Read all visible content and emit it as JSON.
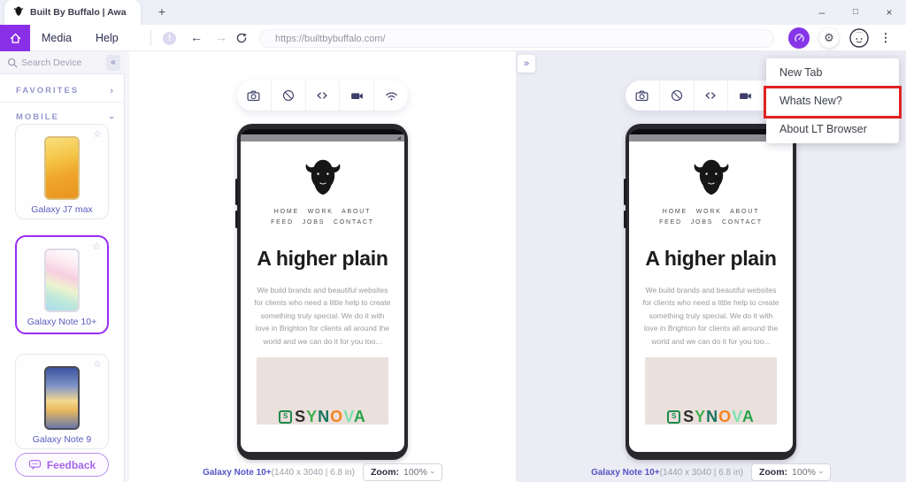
{
  "titlebar": {
    "tab_title": "Built By Buffalo | Awa"
  },
  "icons": {
    "plus": "+",
    "minimize": "–",
    "maximize": "□",
    "close": "×",
    "warning": "!",
    "back_arrow": "←",
    "forward_arrow": "→",
    "kebab": "⋮",
    "collapse": "«",
    "expand": "»",
    "chevron": "›",
    "star": "☆"
  },
  "menubar": {
    "media": "Media",
    "help": "Help"
  },
  "urlbar": {
    "value": "https://builtbybuffalo.com/"
  },
  "dropdown": {
    "items": [
      {
        "label": "New Tab",
        "highlighted": false
      },
      {
        "label": "Whats New?",
        "highlighted": true
      },
      {
        "label": "About LT Browser",
        "highlighted": false
      }
    ]
  },
  "sidebar": {
    "search_placeholder": "Search Device",
    "sections": {
      "favorites": "FAVORITES",
      "mobile": "MOBILE"
    },
    "devices": [
      {
        "name": "Galaxy J7 max"
      },
      {
        "name": "Galaxy Note 10+",
        "selected": true
      },
      {
        "name": "Galaxy Note 9"
      }
    ],
    "feedback_label": "Feedback"
  },
  "panels": {
    "device_name": "Galaxy Note 10+",
    "device_specs": "(1440 x 3040 | 6.8 in)",
    "zoom_label": "Zoom:",
    "zoom_value": "100%"
  },
  "website": {
    "nav_line1": "HOME WORK ABOUT",
    "nav_line2": "FEED JOBS CONTACT",
    "heading": "A higher plain",
    "paragraph": "We build brands and beautiful websites for clients who need a little help to create something truly special. We do it with love in Brighton for clients all around the world and we can do it for you too...",
    "synova": {
      "icon_char": "S",
      "icon_color": "#1f8a4c",
      "letters": [
        {
          "ch": "S",
          "color": "#2d2d2d"
        },
        {
          "ch": "Y",
          "color": "#3faf4e"
        },
        {
          "ch": "N",
          "color": "#16735e"
        },
        {
          "ch": "O",
          "color": "#f5831f"
        },
        {
          "ch": "V",
          "color": "#7de3ae"
        },
        {
          "ch": "A",
          "color": "#27a349"
        }
      ]
    }
  },
  "colors": {
    "accent": "#8a2fe8",
    "selected_card_border": "#9b2cf5",
    "highlight_box": "#e02222",
    "pink_block": "#ebe0dc",
    "right_panel_bg": "#ececf4"
  }
}
